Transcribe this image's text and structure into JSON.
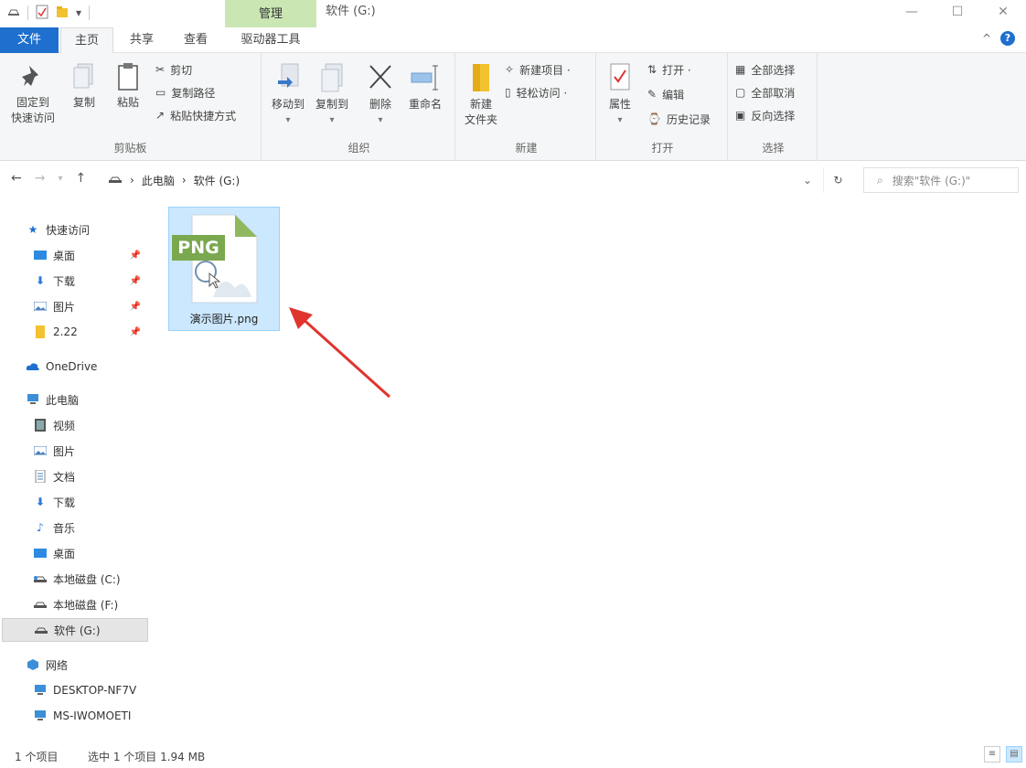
{
  "window": {
    "context_tab": "管理",
    "title": "软件 (G:)",
    "controls": [
      "—",
      "☐",
      "✕"
    ]
  },
  "tabs": {
    "file": "文件",
    "home": "主页",
    "share": "共享",
    "view": "查看",
    "drive_tools": "驱动器工具",
    "help": "?"
  },
  "ribbon": {
    "clipboard": {
      "label": "剪贴板",
      "pin_quick_access": "固定到\n快速访问",
      "copy": "复制",
      "paste": "粘贴",
      "cut": "剪切",
      "copy_path": "复制路径",
      "paste_shortcut": "粘贴快捷方式"
    },
    "organize": {
      "label": "组织",
      "move_to": "移动到",
      "copy_to": "复制到",
      "delete": "删除",
      "rename": "重命名"
    },
    "new": {
      "label": "新建",
      "new_folder": "新建\n文件夹",
      "new_item": "新建项目 ·",
      "easy_access": "轻松访问 ·"
    },
    "open": {
      "label": "打开",
      "properties": "属性",
      "open": "打开 ·",
      "edit": "编辑",
      "history": "历史记录"
    },
    "select": {
      "label": "选择",
      "select_all": "全部选择",
      "select_none": "全部取消",
      "invert": "反向选择"
    }
  },
  "address": {
    "segments": [
      "此电脑",
      "软件 (G:)"
    ],
    "search_placeholder": "搜索\"软件 (G:)\""
  },
  "sidebar": {
    "quick_access": "快速访问",
    "quick_items": [
      {
        "label": "桌面",
        "icon": "desktop-icon"
      },
      {
        "label": "下载",
        "icon": "download-icon"
      },
      {
        "label": "图片",
        "icon": "pictures-icon"
      },
      {
        "label": "2.22",
        "icon": "folder-icon"
      }
    ],
    "onedrive": "OneDrive",
    "this_pc": "此电脑",
    "pc_items": [
      {
        "label": "视频",
        "icon": "video-icon"
      },
      {
        "label": "图片",
        "icon": "pictures-icon"
      },
      {
        "label": "文档",
        "icon": "documents-icon"
      },
      {
        "label": "下载",
        "icon": "download-icon"
      },
      {
        "label": "音乐",
        "icon": "music-icon"
      },
      {
        "label": "桌面",
        "icon": "desktop-icon"
      },
      {
        "label": "本地磁盘 (C:)",
        "icon": "drive-icon"
      },
      {
        "label": "本地磁盘 (F:)",
        "icon": "drive-icon"
      },
      {
        "label": "软件 (G:)",
        "icon": "drive-icon"
      }
    ],
    "network": "网络",
    "network_items": [
      {
        "label": "DESKTOP-NF7V",
        "icon": "computer-icon"
      },
      {
        "label": "MS-IWOMOETI",
        "icon": "computer-icon"
      }
    ]
  },
  "content": {
    "file": {
      "badge": "PNG",
      "name": "演示图片.png"
    }
  },
  "status": {
    "count": "1 个项目",
    "selected": "选中 1 个项目  1.94 MB"
  },
  "colors": {
    "accent": "#1e6fce",
    "manage_tab": "#c9e6b3",
    "selection": "#cce8ff",
    "png_badge": "#7aa84f",
    "arrow": "#e0342e"
  }
}
